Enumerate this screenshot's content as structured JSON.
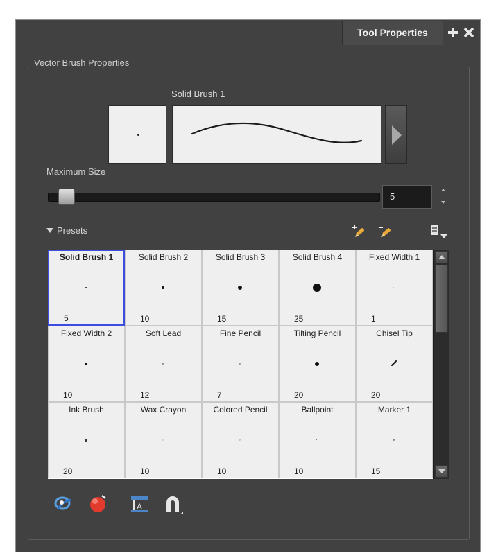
{
  "panel": {
    "tab_title": "Tool Properties",
    "group_title": "Vector Brush Properties"
  },
  "brush": {
    "name": "Solid Brush 1",
    "max_size_label": "Maximum Size",
    "max_size_value": "5",
    "slider_fraction": 0.02
  },
  "presets": {
    "header": "Presets",
    "items": [
      {
        "name": "Solid Brush 1",
        "size": "5",
        "selected": true
      },
      {
        "name": "Solid Brush 2",
        "size": "10"
      },
      {
        "name": "Solid Brush 3",
        "size": "15"
      },
      {
        "name": "Solid Brush 4",
        "size": "25"
      },
      {
        "name": "Fixed Width 1",
        "size": "1"
      },
      {
        "name": "Fixed Width 2",
        "size": "10"
      },
      {
        "name": "Soft Lead",
        "size": "12"
      },
      {
        "name": "Fine Pencil",
        "size": "7"
      },
      {
        "name": "Tilting Pencil",
        "size": "20"
      },
      {
        "name": "Chisel Tip",
        "size": "20"
      },
      {
        "name": "Ink Brush",
        "size": "20"
      },
      {
        "name": "Wax Crayon",
        "size": "10"
      },
      {
        "name": "Colored Pencil",
        "size": "10"
      },
      {
        "name": "Ballpoint",
        "size": "10"
      },
      {
        "name": "Marker 1",
        "size": "15"
      }
    ]
  },
  "colors": {
    "panel_bg": "#414141",
    "selection": "#3c4de0",
    "swatch_bg": "#efefef"
  },
  "icons": {
    "titlebar": [
      "add-icon",
      "close-icon"
    ],
    "presets_toolbar": [
      "new-preset-icon",
      "rename-preset-icon",
      "preset-menu-icon"
    ],
    "bottom_toolbar": [
      "auto-flatten-icon",
      "auto-fill-icon",
      "snap-to-line-icon",
      "magnet-icon"
    ]
  }
}
